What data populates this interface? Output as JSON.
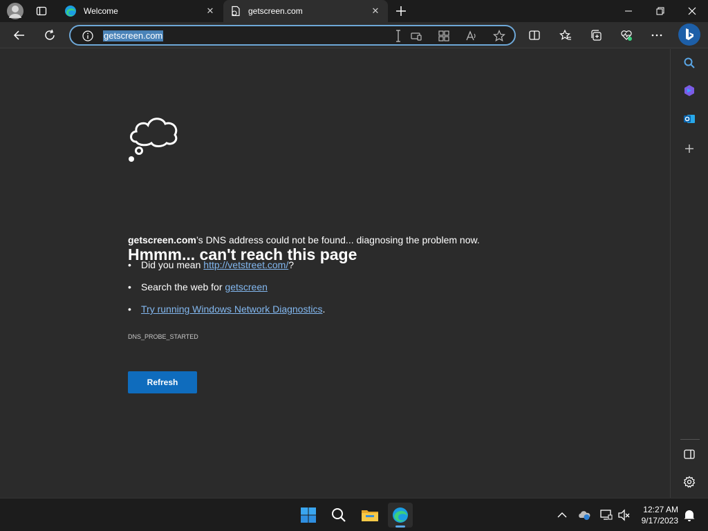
{
  "tabs": [
    {
      "label": "Welcome"
    },
    {
      "label": "getscreen.com"
    }
  ],
  "address": {
    "url": "getscreen.com"
  },
  "error": {
    "title": "Hmmm... can't reach this page",
    "host": "getscreen.com",
    "description_rest": "’s DNS address could not be found... diagnosing the problem now.",
    "suggestion1_prefix": "Did you mean ",
    "suggestion1_link": "http://vetstreet.com/",
    "suggestion1_suffix": "?",
    "suggestion2_prefix": "Search the web for ",
    "suggestion2_link": "getscreen",
    "suggestion3_link": "Try running Windows Network Diagnostics",
    "suggestion3_suffix": ".",
    "code": "DNS_PROBE_STARTED",
    "button_label": "Refresh"
  },
  "clock": {
    "time": "12:27 AM",
    "date": "9/17/2023"
  },
  "colors": {
    "accent": "#0f6cbd",
    "link": "#83b8f0",
    "selection": "#4a83b8"
  }
}
